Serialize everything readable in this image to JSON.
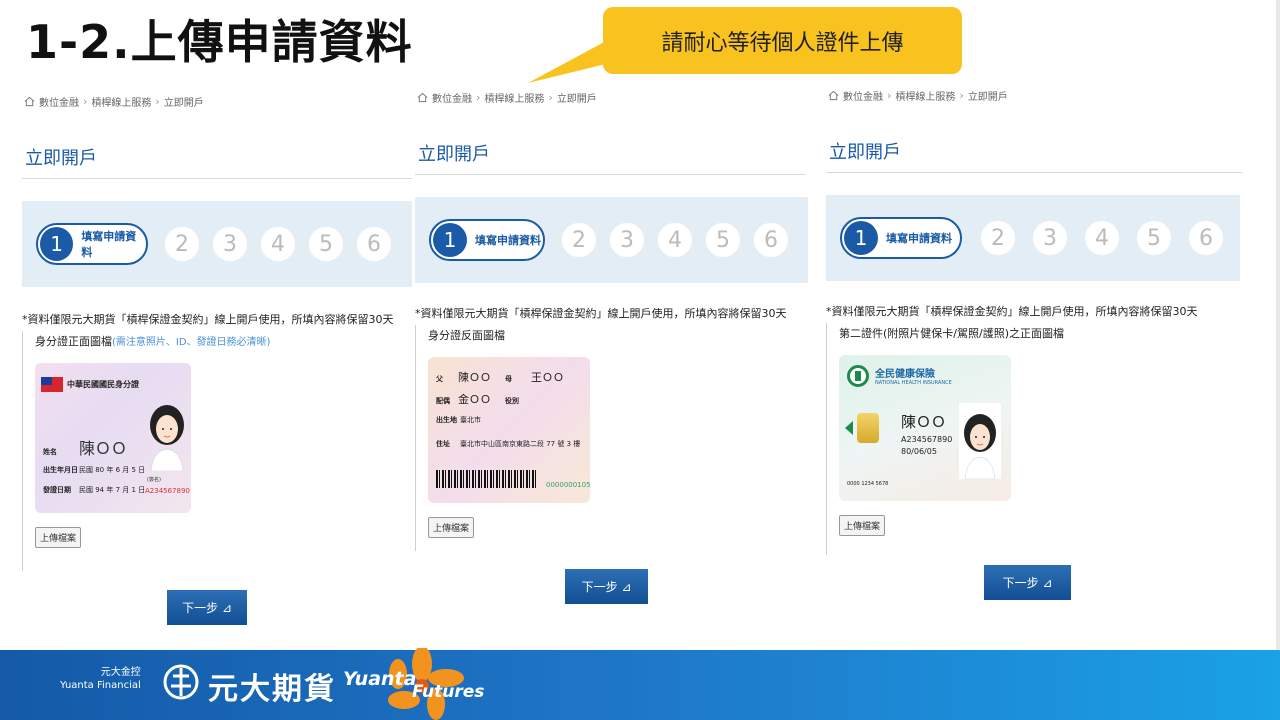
{
  "slide": {
    "title": "1-2.上傳申請資料",
    "callout": "請耐心等待個人證件上傳"
  },
  "breadcrumb": [
    "數位金融",
    "槓桿線上服務",
    "立即開戶"
  ],
  "page_heading": "立即開戶",
  "stepper": {
    "active_num": "1",
    "active_label": "填寫申請資料",
    "steps": [
      "2",
      "3",
      "4",
      "5",
      "6"
    ]
  },
  "notice": "*資料僅限元大期貨「槓桿保證金契約」線上開戶使用，所填內容將保留30天",
  "panels": [
    {
      "label": "身分證正面圖檔",
      "hint": "(需注意照片、ID、發證日務必清晰)",
      "card": {
        "title": "中華民國國民身分證",
        "rows": [
          {
            "k": "姓名",
            "v": "陳ＯＯ"
          },
          {
            "k": "出生年月日",
            "v": "民國 80 年 6 月 5 日"
          },
          {
            "k": "發證日期",
            "v": "民國 94 年 7 月 1 日"
          }
        ],
        "id_number": "A234567890",
        "sign_label": "(簽名)"
      },
      "upload_label": "上傳檔案"
    },
    {
      "label": "身分證反面圖檔",
      "card": {
        "rows": [
          {
            "k": "父",
            "v": "陳ＯＯ",
            "k2": "母",
            "v2": "王ＯＯ"
          },
          {
            "k": "配偶",
            "v": "金ＯＯ",
            "k2": "役別",
            "v2": ""
          },
          {
            "k": "出生地",
            "v": "臺北市"
          },
          {
            "k": "住址",
            "v": "臺北市中山區南京東路二段 77 號 3 樓"
          }
        ],
        "serial": "0000000105"
      },
      "upload_label": "上傳檔案"
    },
    {
      "label": "第二證件(附照片健保卡/駕照/護照)之正面圖檔",
      "card": {
        "title": "全民健康保險",
        "subtitle": "NATIONAL HEALTH INSURANCE",
        "name": "陳ＯＯ",
        "id_number": "A234567890",
        "birth": "80/06/05",
        "card_no": "0000 1234 5678"
      },
      "upload_label": "上傳檔案"
    }
  ],
  "next_label": "下一步 ⊿",
  "footer": {
    "group_cn": "元大金控",
    "group_en": "Yuanta Financial",
    "brand_cn": "元大期貨",
    "brand_en1": "Yuanta",
    "brand_en2": "Futures"
  },
  "colors": {
    "accent": "#1a5aa6",
    "callout": "#f8c21f",
    "stepper_bg": "#e3edf6"
  }
}
